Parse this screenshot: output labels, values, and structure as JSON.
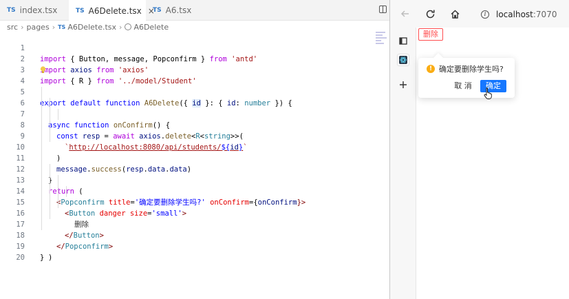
{
  "editor": {
    "tabs": [
      {
        "label": "index.tsx",
        "badge": "TS",
        "active": false
      },
      {
        "label": "A6Delete.tsx",
        "badge": "TS",
        "active": true,
        "close": "×"
      },
      {
        "label": "A6.tsx",
        "badge": "TS",
        "active": false
      }
    ],
    "breadcrumb": {
      "src": "src",
      "pages": "pages",
      "file_badge": "TS",
      "file": "A6Delete.tsx",
      "symbol": "A6Delete",
      "separator": "›"
    },
    "line_numbers": [
      "1",
      "2",
      "3",
      "4",
      "5",
      "6",
      "7",
      "8",
      "9",
      "10",
      "11",
      "12",
      "13",
      "14",
      "15",
      "16",
      "17",
      "18",
      "19",
      "20"
    ],
    "code": {
      "l1": {
        "kw": "import",
        "mid": " { Button, message, Popconfirm } ",
        "from": "from",
        "str": " 'antd'"
      },
      "l2": {
        "kw": "import",
        "mid": " axios ",
        "from": "from",
        "str": " 'axios'"
      },
      "l3": {
        "kw": "import",
        "mid": " { R } ",
        "from": "from",
        "str": " '../model/Student'"
      },
      "l5": {
        "kw1": "export",
        "kw2": " default",
        "kw3": " function",
        "fn": " A6Delete",
        "p1": "({ ",
        "id": "id",
        "p2": " }: { ",
        "id2": "id",
        "p3": ": ",
        "tp": "number",
        "p4": " }) {"
      },
      "l6": {
        "kw1": "async",
        "kw2": " function",
        "fn": " onConfirm",
        "p": "() {"
      },
      "l7": {
        "kw": "const",
        "id": " resp",
        "p1": " = ",
        "kw2": "await",
        "id2": " axios",
        "p2": ".",
        "fn": "delete",
        "p3": "<",
        "tp": "R",
        "p4": "<",
        "tp2": "string",
        "p5": ">>("
      },
      "l8": {
        "tick": "`",
        "url": "http://localhost:8080/api/students/",
        "ph": "${",
        "id": "id",
        "ph2": "}",
        "tick2": "`"
      },
      "l9": {
        "p": ")"
      },
      "l10": {
        "id": "message",
        "p1": ".",
        "fn": "success",
        "p2": "(",
        "id2": "resp",
        "p3": ".",
        "id3": "data",
        "p4": ".",
        "id4": "data",
        "p5": ")"
      },
      "l11": {
        "p": "}"
      },
      "l12": {
        "kw": "return",
        "p": " ("
      },
      "l13": {
        "open": "<",
        "tag": "Popconfirm",
        "attr": " title",
        "eq": "=",
        "str": "'确定要删除学生吗?'",
        "attr2": " onConfirm",
        "eq2": "={",
        "id": "onConfirm",
        "close": "}>"
      },
      "l14": {
        "open": "<",
        "tag": "Button",
        "attr": " danger",
        "attr2": " size",
        "eq": "=",
        "str": "'small'",
        "close": ">"
      },
      "l15": {
        "txt": "删除"
      },
      "l16": {
        "open": "</",
        "tag": "Button",
        "close": ">"
      },
      "l17": {
        "open": "</",
        "tag": "Popconfirm",
        "close": ">"
      },
      "l18": {
        "p": ")"
      },
      "l19": {
        "p": "}"
      }
    }
  },
  "browser": {
    "url": "localhost",
    "port": ":7070",
    "page": {
      "delete_button": "删除",
      "popconfirm": {
        "message": "确定要删除学生吗?",
        "warn_glyph": "!",
        "cancel": "取 消",
        "ok": "确定"
      }
    }
  },
  "colors": {
    "keyword": "#0000ff",
    "control": "#af00db",
    "string": "#a31515",
    "danger": "#ff4d4f",
    "primary": "#1677ff",
    "warning": "#faad14"
  }
}
